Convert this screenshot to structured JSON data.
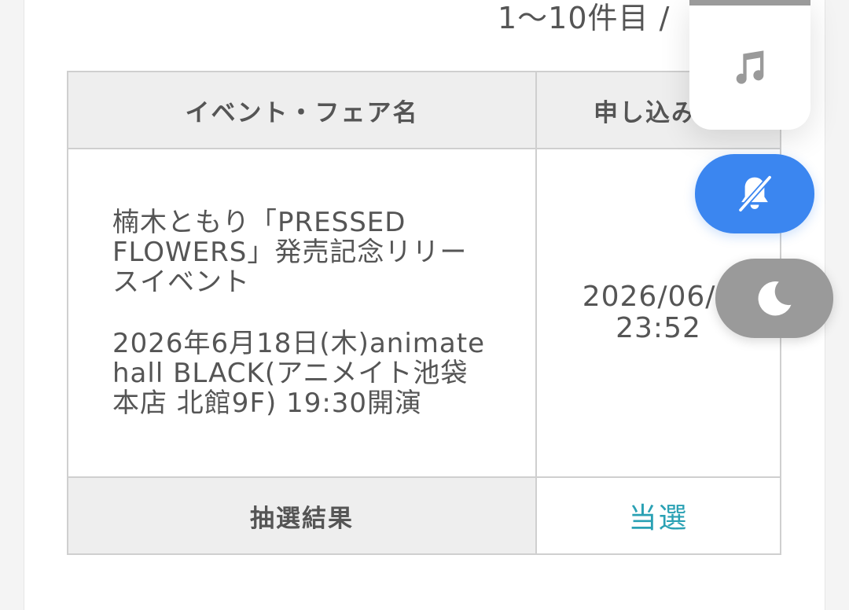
{
  "pager": {
    "count_text": "1〜10件目 /"
  },
  "table": {
    "headers": {
      "event_name": "イベント・フェア名",
      "apply_date": "申し込み日"
    },
    "row": {
      "event_title": "楠木ともり「PRESSED FLOWERS」発売記念リリースイベント",
      "event_detail": "2026年6月18日(木)animate hall BLACK(アニメイト池袋本店 北館9F) 19:30開演",
      "apply_date_line1": "2026/06/0",
      "apply_date_line2": "23:52"
    },
    "result": {
      "label": "抽選結果",
      "value": "当選"
    }
  },
  "widgets": {
    "music_icon": "music-note-icon",
    "bell_icon": "bell-slash-icon",
    "moon_icon": "moon-icon",
    "bell_color": "#3b86f0",
    "moon_color": "#9a9a9a"
  },
  "colors": {
    "result_accent": "#2aa1b4"
  }
}
